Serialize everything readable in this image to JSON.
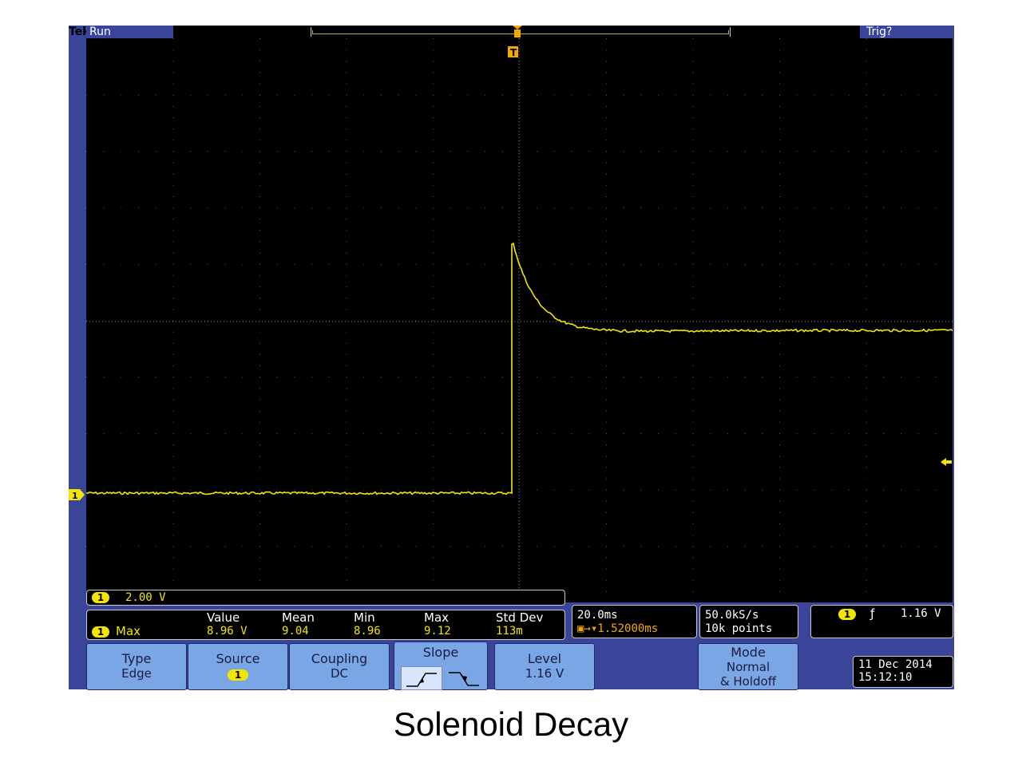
{
  "status": {
    "brand": "Tek",
    "run_state": "Run",
    "trigger_state": "Trig?"
  },
  "channel": {
    "number": "1",
    "scale": "2.00 V",
    "color": "#f2e600"
  },
  "measurement": {
    "name": "Max",
    "headers": [
      "Value",
      "Mean",
      "Min",
      "Max",
      "Std Dev"
    ],
    "values": [
      "8.96 V",
      "9.04",
      "8.96",
      "9.12",
      "113m"
    ]
  },
  "horizontal": {
    "time_per_div": "20.0ms",
    "position": "1.52000ms",
    "sample_rate": "50.0kS/s",
    "record_length": "10k points"
  },
  "trigger": {
    "slope_symbol": "ƒ",
    "level": "1.16 V"
  },
  "menu": {
    "type_title": "Type",
    "type_value": "Edge",
    "source_title": "Source",
    "source_value": "1",
    "coupling_title": "Coupling",
    "coupling_value": "DC",
    "slope_title": "Slope",
    "level_title": "Level",
    "level_value": "1.16 V",
    "mode_title": "Mode",
    "mode_value": "Normal",
    "mode_holdoff": "& Holdoff"
  },
  "datetime": {
    "date": "11 Dec 2014",
    "time": "15:12:10"
  },
  "caption": "Solenoid Decay",
  "colors": {
    "frame": "#3a4499",
    "trace": "#f2e600",
    "menu": "#7aa6e6",
    "marker": "#f2a900"
  }
}
